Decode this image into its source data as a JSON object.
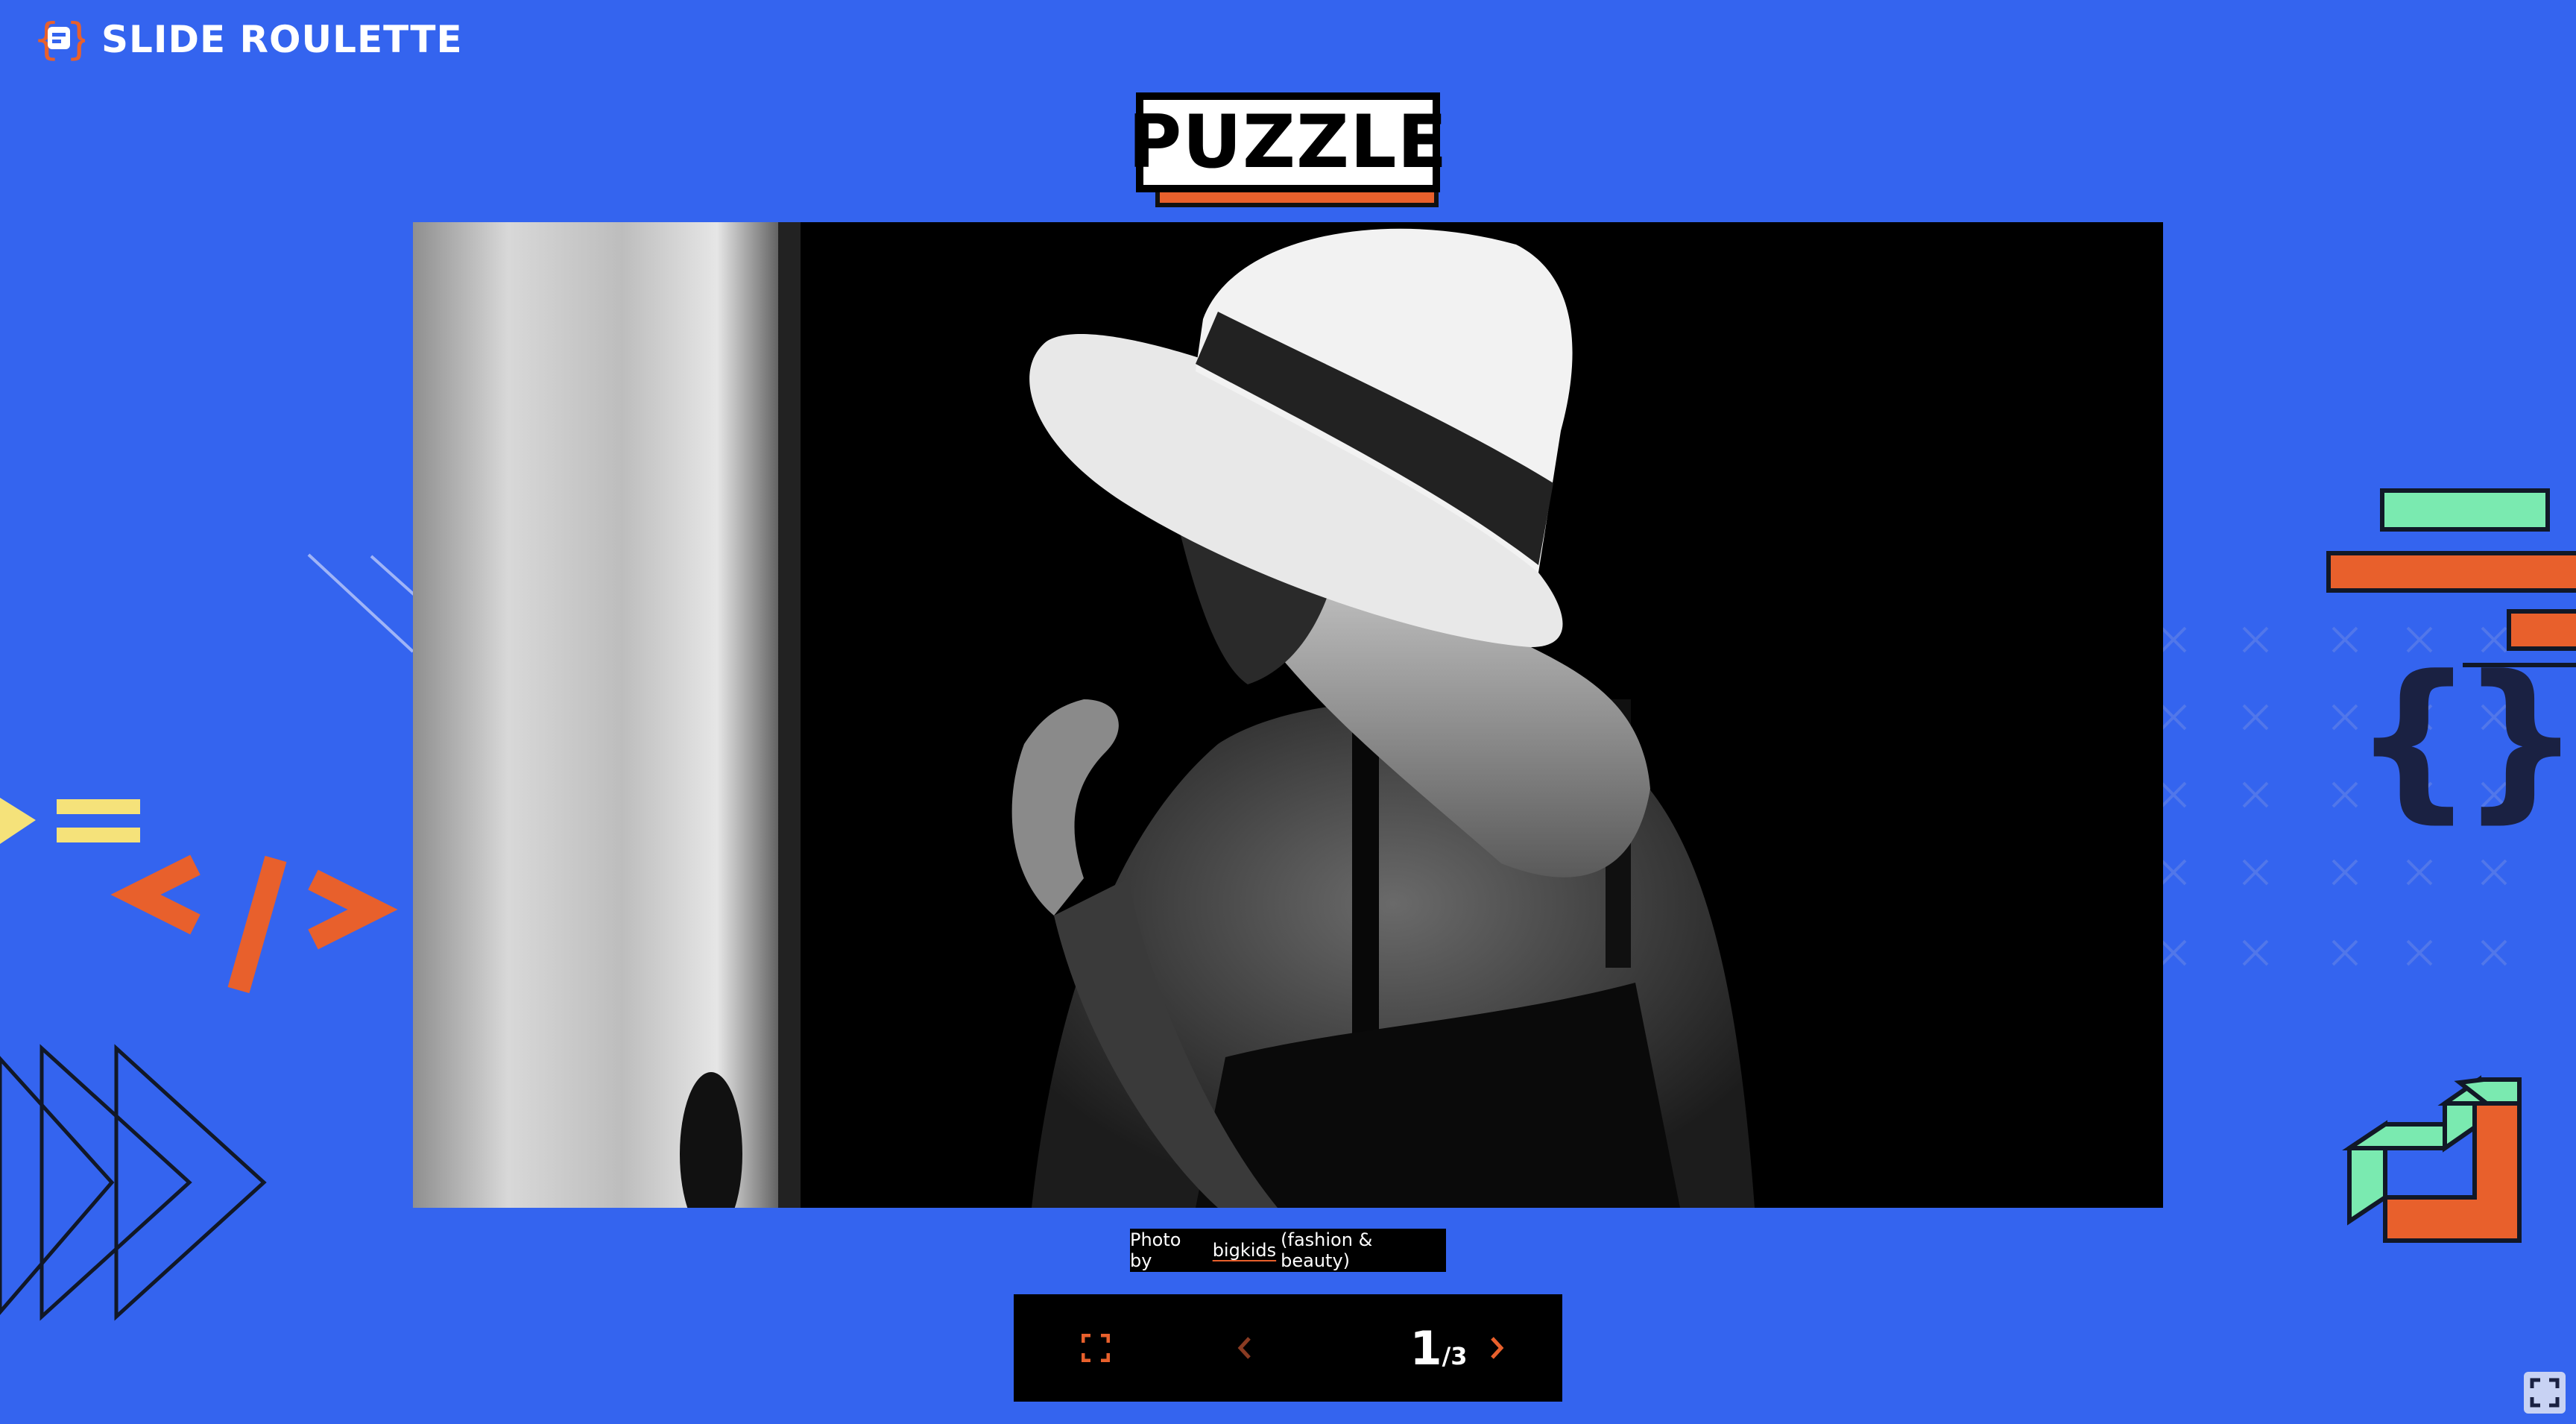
{
  "app": {
    "title": "SLIDE ROULETTE",
    "logo_icon": "curly-brace-chat-icon"
  },
  "slide": {
    "heading": "PUZZLE",
    "photo_alt": "Black and white photo of a woman in a white sun hat",
    "caption": {
      "prefix": "Photo by",
      "author": "bigkids",
      "suffix": "(fashion & beauty)"
    }
  },
  "controls": {
    "fullscreen_icon": "expand-icon",
    "prev_icon": "chevron-left-icon",
    "next_icon": "chevron-right-icon",
    "current": "1",
    "total": "/3"
  },
  "corner": {
    "fullscreen_icon": "fullscreen-icon"
  },
  "colors": {
    "background": "#3464ef",
    "accent_orange": "#e8602c",
    "accent_green": "#7aeab0",
    "accent_yellow": "#f5e27a",
    "ink": "#111827"
  }
}
